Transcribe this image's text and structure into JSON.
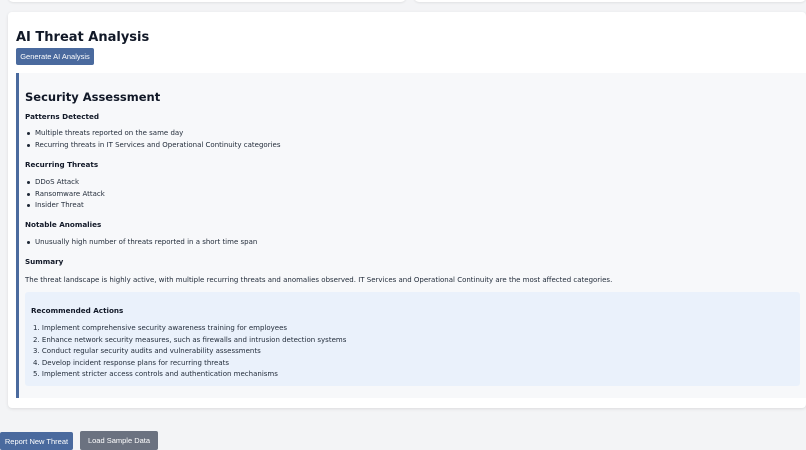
{
  "section_title": "AI Threat Analysis",
  "generate_button": "Generate AI Analysis",
  "assessment": {
    "title": "Security Assessment",
    "patterns": {
      "heading": "Patterns Detected",
      "items": [
        "Multiple threats reported on the same day",
        "Recurring threats in IT Services and Operational Continuity categories"
      ]
    },
    "recurring": {
      "heading": "Recurring Threats",
      "items": [
        "DDoS Attack",
        "Ransomware Attack",
        "Insider Threat"
      ]
    },
    "anomalies": {
      "heading": "Notable Anomalies",
      "items": [
        "Unusually high number of threats reported in a short time span"
      ]
    },
    "summary": {
      "heading": "Summary",
      "text": "The threat landscape is highly active, with multiple recurring threats and anomalies observed. IT Services and Operational Continuity are the most affected categories."
    },
    "recommended": {
      "heading": "Recommended Actions",
      "items": [
        "1. Implement comprehensive security awareness training for employees",
        "2. Enhance network security measures, such as firewalls and intrusion detection systems",
        "3. Conduct regular security audits and vulnerability assessments",
        "4. Develop incident response plans for recurring threats",
        "5. Implement stricter access controls and authentication mechanisms"
      ]
    }
  },
  "footer": {
    "report_button": "Report New Threat",
    "sample_button": "Load Sample Data"
  },
  "colors": {
    "accent": "#4a6a9e",
    "secondary_button": "#6b7280",
    "recommendation_bg": "#eaf1fb"
  }
}
